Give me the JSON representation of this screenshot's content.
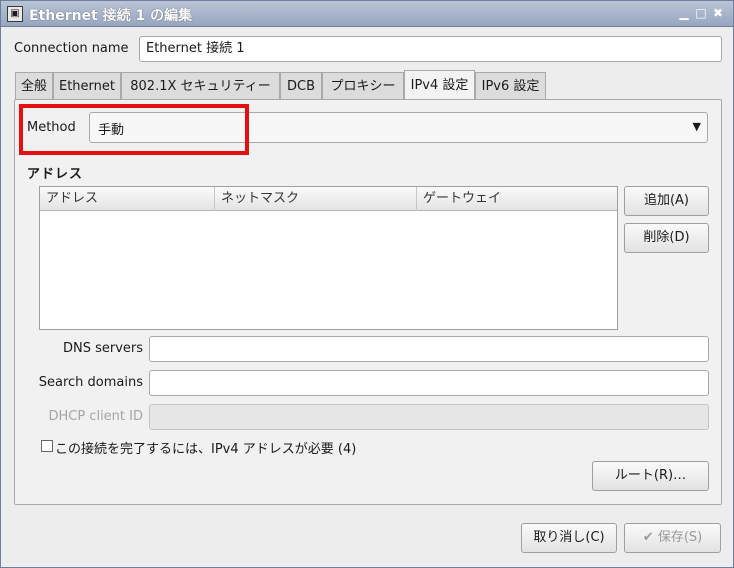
{
  "window": {
    "title": "Ethernet 接続 1 の編集",
    "app_icon": "terminal-icon",
    "controls": [
      "minimize-icon",
      "maximize-icon",
      "close-icon"
    ],
    "control_glyphs": {
      "minimize": "▁",
      "maximize": "□",
      "close": "✖"
    }
  },
  "connection": {
    "label": "Connection name",
    "value": "Ethernet 接続 1"
  },
  "tabs": [
    {
      "label": "全般",
      "active": false
    },
    {
      "label": "Ethernet",
      "active": false
    },
    {
      "label": "802.1X セキュリティー",
      "active": false
    },
    {
      "label": "DCB",
      "active": false
    },
    {
      "label": "プロキシー",
      "active": false
    },
    {
      "label": "IPv4 設定",
      "active": true
    },
    {
      "label": "IPv6 設定",
      "active": false
    }
  ],
  "ipv4": {
    "method_label": "Method",
    "method_value": "手動",
    "method_arrow": "▼",
    "address_heading": "アドレス",
    "columns": [
      "アドレス",
      "ネットマスク",
      "ゲートウェイ"
    ],
    "add_button": "追加(A)",
    "delete_button": "削除(D)",
    "dns_label": "DNS servers",
    "dns_value": "",
    "search_label": "Search domains",
    "search_value": "",
    "dhcp_label": "DHCP client ID",
    "dhcp_value": "",
    "require_label": "この接続を完了するには、IPv4 アドレスが必要 (4)",
    "require_checked": false,
    "routes_button": "ルート(R)…"
  },
  "footer": {
    "cancel_button": "取り消し(C)",
    "save_button": "保存(S)",
    "save_icon": "✔"
  },
  "colors": {
    "highlight": "#e41010",
    "titlebar": "#97a6bf"
  }
}
